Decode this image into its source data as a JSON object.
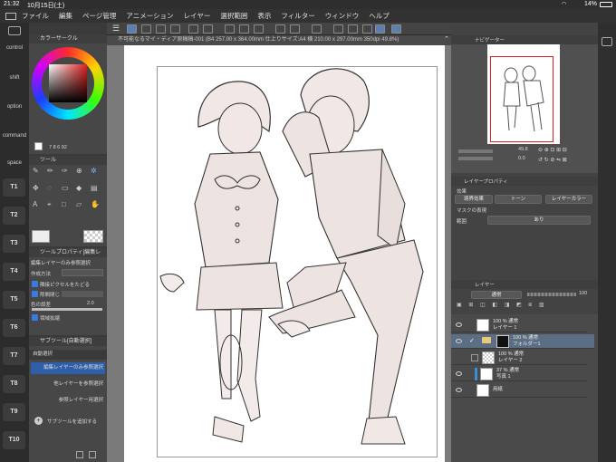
{
  "status": {
    "time": "21:32",
    "date": "10月15日(土)",
    "battery": "14%"
  },
  "menu": [
    "ファイル",
    "編集",
    "ページ管理",
    "アニメーション",
    "レイヤー",
    "選択範囲",
    "表示",
    "フィルター",
    "ウィンドウ",
    "ヘルプ"
  ],
  "left_strip": {
    "keys": [
      "control",
      "shift",
      "option",
      "command",
      "space"
    ],
    "tool_keys": [
      "T1",
      "T2",
      "T3",
      "T4",
      "T5",
      "T6",
      "T7",
      "T8",
      "T9",
      "T10"
    ]
  },
  "color_circle": {
    "title": "カラーサークル",
    "values": "7 8 6 92"
  },
  "tool_panel": {
    "title": "ツール"
  },
  "tool_property": {
    "title": "ツールプロパティ[編集レ",
    "subtitle": "編集レイヤーのみ参照選択",
    "row1_label": "作成方法",
    "row2_label": "隣接ピクセルをたどる",
    "row3_label": "隙間閉じ",
    "row4_label": "色の誤差",
    "row4_value": "2.0",
    "row5_label": "領域拡縮"
  },
  "subtool_panel": {
    "title": "サブツール[自動選択]",
    "group_label": "自動選択",
    "items": [
      "編集レイヤーのみ参照選択",
      "他レイヤーを参照選択",
      "参照レイヤー用選択"
    ],
    "add_label": "サブツールを追加する"
  },
  "document": {
    "tab_title": "不可能なるマイ・ディア原稿稿-001 (B4 257.00 x 364.00mm 仕上りサイズ:A4 横 210.00 x 297.00mm 350dpi 49.8%)"
  },
  "navigator": {
    "title": "ナビゲーター",
    "zoom": "49.8",
    "rotation": "0.0"
  },
  "layer_property": {
    "title": "レイヤープロパティ",
    "effect_label": "効果",
    "border_effect": "境界効果",
    "tone": "トーン",
    "layer_color": "レイヤーカラー",
    "mask_label": "マスクの表現",
    "area_label": "範囲",
    "area_value": "あり"
  },
  "layer_panel": {
    "title": "レイヤー",
    "blend_mode": "通常",
    "opacity": "100",
    "layers": [
      {
        "line1": "100 % 通常",
        "line2": "レイヤー 1",
        "active": false
      },
      {
        "line1": "100 % 通常",
        "line2": "フォルダー1",
        "active": true
      },
      {
        "line1": "100 % 通常",
        "line2": "レイヤー 2",
        "active": false
      },
      {
        "line1": "37 % 通常",
        "line2": "写真 1",
        "active": false
      },
      {
        "line1": "",
        "line2": "用紙",
        "active": false
      }
    ]
  },
  "colors": {
    "accent": "#5c6e84",
    "panel": "#474747",
    "dark": "#2c2c2c"
  }
}
